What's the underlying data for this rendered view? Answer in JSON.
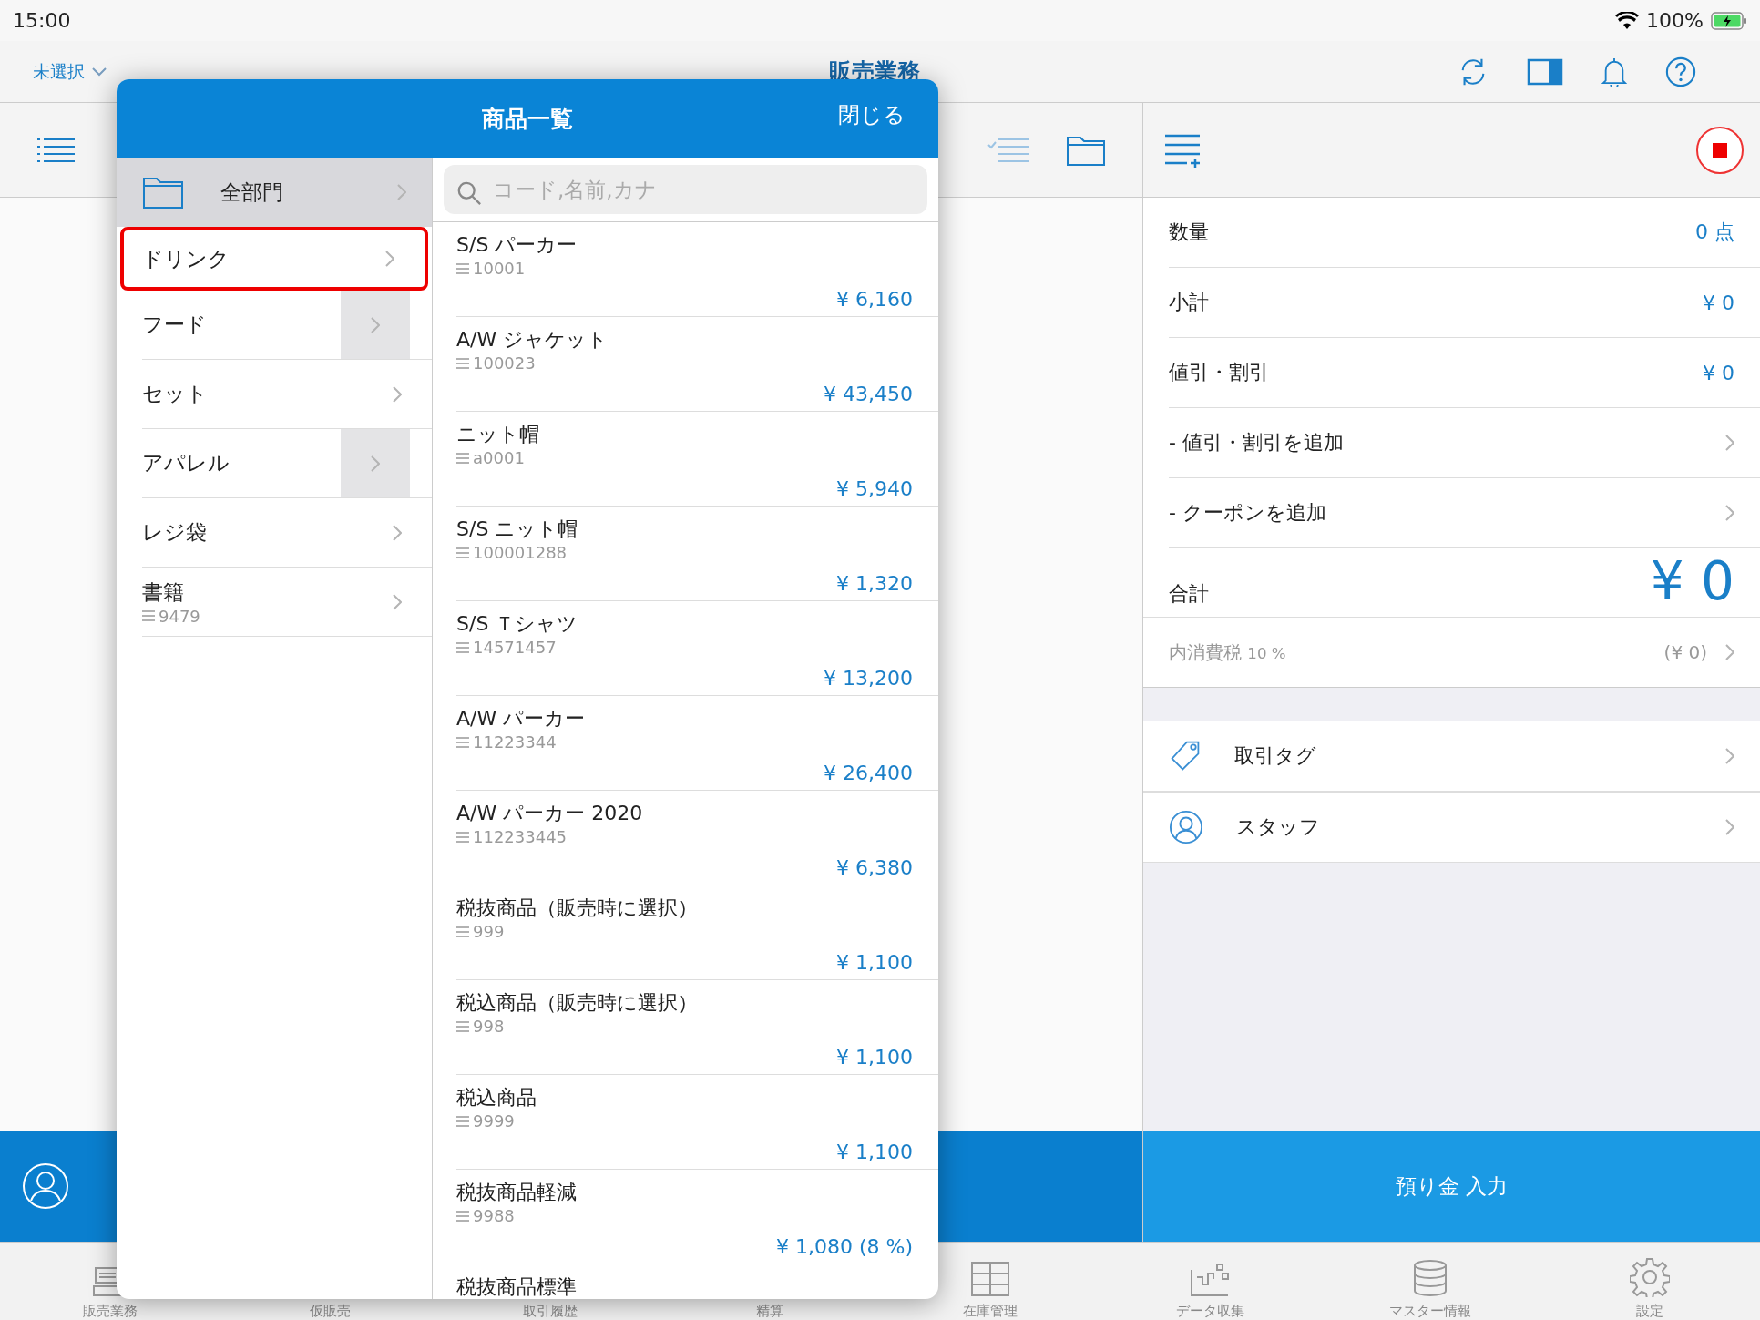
{
  "status_bar": {
    "time": "15:00",
    "battery": "100%"
  },
  "nav_bar": {
    "selector": "未選択",
    "title": "販売業務"
  },
  "sale_panel": {
    "rows": [
      {
        "kind": "value",
        "label": "数量",
        "value": "0 点"
      },
      {
        "kind": "value",
        "label": "小計",
        "value": "¥ 0"
      },
      {
        "kind": "value",
        "label": "値引・割引",
        "value": "¥ 0"
      },
      {
        "kind": "action",
        "label": "- 値引・割引を追加"
      },
      {
        "kind": "action",
        "label": "- クーポンを追加"
      }
    ],
    "total": {
      "label": "合計",
      "value": "¥ 0"
    },
    "tax": {
      "label": "内消費税",
      "rate": "10 %",
      "value": "(¥ 0)"
    },
    "extras": [
      {
        "kind": "tag",
        "label": "取引タグ"
      },
      {
        "kind": "staff",
        "label": "スタッフ"
      }
    ],
    "deposit_button": "預り金 入力"
  },
  "product_popover": {
    "title": "商品一覧",
    "close": "閉じる",
    "root_category": "全部門",
    "search": {
      "placeholder": "コード,名前,カナ"
    },
    "categories": [
      {
        "name": "ドリンク",
        "selected": true,
        "has_subcategories": false
      },
      {
        "name": "フード",
        "selected": false,
        "has_subcategories": true
      },
      {
        "name": "セット",
        "selected": false,
        "has_subcategories": false
      },
      {
        "name": "アパレル",
        "selected": false,
        "has_subcategories": true
      },
      {
        "name": "レジ袋",
        "selected": false,
        "has_subcategories": false
      },
      {
        "name": "書籍",
        "code": "9479",
        "selected": false,
        "has_subcategories": false
      }
    ],
    "products": [
      {
        "name": "S/S パーカー",
        "code": "10001",
        "price": "¥ 6,160"
      },
      {
        "name": "A/W ジャケット",
        "code": "100023",
        "price": "¥ 43,450"
      },
      {
        "name": "ニット帽",
        "code": "a0001",
        "price": "¥ 5,940"
      },
      {
        "name": "S/S ニット帽",
        "code": "100001288",
        "price": "¥ 1,320"
      },
      {
        "name": "S/S Ｔシャツ",
        "code": "14571457",
        "price": "¥ 13,200"
      },
      {
        "name": "A/W パーカー",
        "code": "11223344",
        "price": "¥ 26,400"
      },
      {
        "name": "A/W パーカー 2020",
        "code": "112233445",
        "price": "¥ 6,380"
      },
      {
        "name": "税抜商品（販売時に選択）",
        "code": "999",
        "price": "¥ 1,100"
      },
      {
        "name": "税込商品（販売時に選択）",
        "code": "998",
        "price": "¥ 1,100"
      },
      {
        "name": "税込商品",
        "code": "9999",
        "price": "¥ 1,100"
      },
      {
        "name": "税抜商品軽減",
        "code": "9988",
        "price": "¥ 1,080 (8 %)"
      },
      {
        "name": "税抜商品標準"
      }
    ]
  },
  "tab_bar": [
    {
      "label": "販売業務",
      "kind": "register"
    },
    {
      "label": "仮販売"
    },
    {
      "label": "取引履歴"
    },
    {
      "label": "精算"
    },
    {
      "label": "在庫管理",
      "kind": "cabinet"
    },
    {
      "label": "データ収集",
      "kind": "chart"
    },
    {
      "label": "マスター情報",
      "kind": "database"
    },
    {
      "label": "設定",
      "kind": "gear"
    }
  ]
}
